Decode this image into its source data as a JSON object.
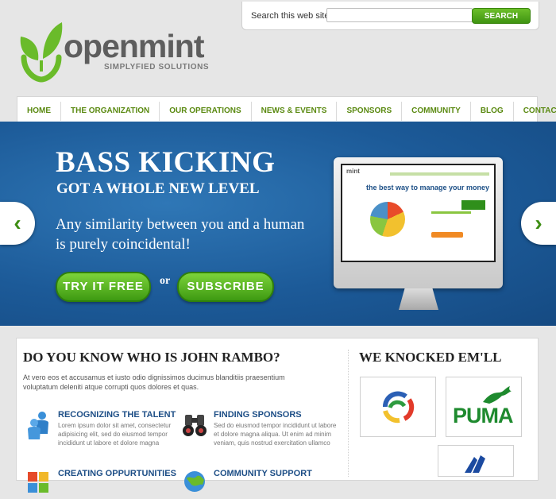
{
  "search": {
    "label": "Search this web site",
    "placeholder": "",
    "button_label": "SEARCH"
  },
  "brand": {
    "name": "openmint",
    "tagline": "SIMPLYFIED SOLUTIONS",
    "color": "#6abb2a"
  },
  "nav": {
    "items": [
      "HOME",
      "THE ORGANIZATION",
      "OUR OPERATIONS",
      "NEWS & EVENTS",
      "SPONSORS",
      "COMMUNITY",
      "BLOG",
      "CONTACT US"
    ]
  },
  "banner": {
    "title": "BASS KICKING",
    "subtitle": "GOT A WHOLE NEW LEVEL",
    "text": "Any similarity between you and a human is purely coincidental!",
    "try_label": "TRY IT FREE",
    "or_label": "or",
    "subscribe_label": "SUBSCRIBE",
    "screen_brand": "mint",
    "screen_tagline": "the best way to manage your money"
  },
  "about": {
    "title": "DO YOU KNOW WHO IS JOHN RAMBO?",
    "text": "At vero eos et accusamus et iusto odio dignissimos ducimus blanditiis praesentium voluptatum deleniti atque corrupti quos dolores et quas."
  },
  "features": [
    {
      "title": "RECOGNIZING THE TALENT",
      "text": "Lorem ipsum dolor sit amet, consectetur adipisicing elit, sed do eiusmod tempor incididunt ut labore et dolore magna",
      "icon": "people-icon"
    },
    {
      "title": "FINDING SPONSORS",
      "text": "Sed do eiusmod tempor incididunt ut labore et dolore magna aliqua. Ut enim ad minim veniam, quis nostrud exercitation ullamco",
      "icon": "binoculars-icon"
    },
    {
      "title": "CREATING OPPURTUNITIES",
      "text": "",
      "icon": "puzzle-icon"
    },
    {
      "title": "COMMUNITY SUPPORT",
      "text": "",
      "icon": "globe-icon"
    }
  ],
  "sponsors": {
    "title": "WE KNOCKED EM'LL",
    "logos": [
      "circle-logo",
      "PUMA",
      "adidas-logo"
    ]
  }
}
